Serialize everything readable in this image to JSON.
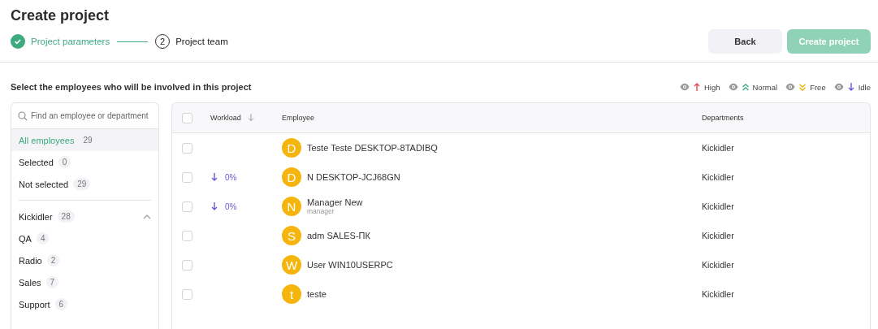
{
  "page_title": "Create project",
  "steps": [
    {
      "label": "Project parameters",
      "done": true
    },
    {
      "number": "2",
      "label": "Project team",
      "done": false
    }
  ],
  "buttons": [
    {
      "label": "Back",
      "disabled": false
    },
    {
      "label": "Create project",
      "disabled": true
    }
  ],
  "subtitle": "Select the employees who will be involved in this project",
  "legend": [
    {
      "kind": "high",
      "label": "High"
    },
    {
      "kind": "normal",
      "label": "Normal"
    },
    {
      "kind": "free",
      "label": "Free"
    },
    {
      "kind": "idle",
      "label": "Idle"
    }
  ],
  "search": {
    "placeholder": "Find an employee or department"
  },
  "filters": [
    {
      "label": "All employees",
      "count": "29",
      "selected": true
    },
    {
      "label": "Selected",
      "count": "0",
      "selected": false
    },
    {
      "label": "Not selected",
      "count": "29",
      "selected": false
    }
  ],
  "departments": [
    {
      "label": "Kickidler",
      "count": "28",
      "expanded": true,
      "children": [
        {
          "label": "QA",
          "count": "4"
        },
        {
          "label": "Radio",
          "count": "2"
        },
        {
          "label": "Sales",
          "count": "7"
        },
        {
          "label": "Support",
          "count": "6"
        }
      ]
    }
  ],
  "table": {
    "header_checked": false,
    "columns": [
      "Workload",
      "Employee",
      "Departments"
    ],
    "rows": [
      {
        "checked": false,
        "avatar": "D",
        "name": "Teste Teste DESKTOP-8TADIBQ",
        "department": "Kickidler"
      },
      {
        "checked": false,
        "workload": {
          "kind": "idle",
          "value": "0%"
        },
        "avatar": "D",
        "name": "N DESKTOP-JCJ68GN",
        "department": "Kickidler"
      },
      {
        "checked": false,
        "workload": {
          "kind": "idle",
          "value": "0%"
        },
        "avatar": "N",
        "name": "Manager New",
        "role": "manager",
        "department": "Kickidler"
      },
      {
        "checked": false,
        "avatar": "S",
        "name": "adm SALES-ПК",
        "department": "Kickidler"
      },
      {
        "checked": false,
        "avatar": "W",
        "name": "User WIN10USERPC",
        "department": "Kickidler"
      },
      {
        "checked": false,
        "avatar": "t",
        "name": "teste",
        "department": "Kickidler"
      }
    ]
  }
}
